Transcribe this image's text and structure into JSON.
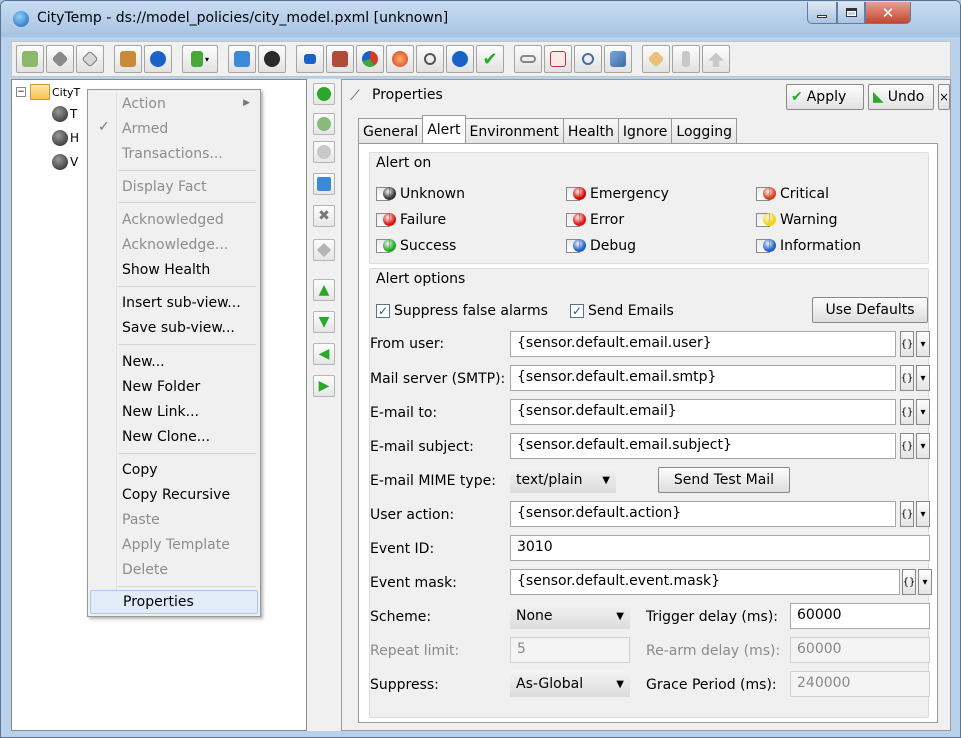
{
  "window": {
    "title": "CityTemp - ds://model_policies/city_model.pxml [unknown]"
  },
  "tree": {
    "root_label": "CityT",
    "children": [
      "T",
      "H",
      "V"
    ]
  },
  "context_menu": {
    "items": [
      {
        "label": "Action",
        "disabled": true,
        "submenu": true
      },
      {
        "label": "Armed",
        "disabled": true,
        "checked": true
      },
      {
        "label": "Transactions...",
        "disabled": true
      },
      {
        "label": "Display Fact",
        "disabled": true
      },
      {
        "label": "Acknowledged",
        "disabled": true
      },
      {
        "label": "Acknowledge...",
        "disabled": true
      },
      {
        "label": "Show Health",
        "disabled": false
      },
      {
        "label": "Insert sub-view...",
        "disabled": false
      },
      {
        "label": "Save sub-view...",
        "disabled": false
      },
      {
        "label": "New...",
        "disabled": false
      },
      {
        "label": "New Folder",
        "disabled": false
      },
      {
        "label": "New Link...",
        "disabled": false
      },
      {
        "label": "New Clone...",
        "disabled": false
      },
      {
        "label": "Copy",
        "disabled": false
      },
      {
        "label": "Copy Recursive",
        "disabled": false
      },
      {
        "label": "Paste",
        "disabled": true
      },
      {
        "label": "Apply Template",
        "disabled": true
      },
      {
        "label": "Delete",
        "disabled": true
      },
      {
        "label": "Properties",
        "disabled": false,
        "highlighted": true
      }
    ]
  },
  "properties": {
    "title": "Properties",
    "apply_label": "Apply",
    "undo_label": "Undo",
    "close_label": "×",
    "tabs": [
      "General",
      "Alert",
      "Environment",
      "Health",
      "Ignore",
      "Logging"
    ],
    "active_tab": "Alert"
  },
  "alert_on": {
    "title": "Alert on",
    "items": [
      {
        "label": "Unknown",
        "color": "#333333"
      },
      {
        "label": "Emergency",
        "color": "#d80000"
      },
      {
        "label": "Critical",
        "color": "#d83a1a"
      },
      {
        "label": "Failure",
        "color": "#e01010"
      },
      {
        "label": "Error",
        "color": "#e01010"
      },
      {
        "label": "Warning",
        "color": "#f2d600"
      },
      {
        "label": "Success",
        "color": "#1ca81c"
      },
      {
        "label": "Debug",
        "color": "#1a5fc8"
      },
      {
        "label": "Information",
        "color": "#1a5fc8"
      }
    ]
  },
  "alert_options": {
    "title": "Alert options",
    "suppress_false_alarms": "Suppress false alarms",
    "send_emails": "Send Emails",
    "use_defaults": "Use Defaults",
    "from_user_label": "From user:",
    "from_user_value": "{sensor.default.email.user}",
    "mail_server_label": "Mail server (SMTP):",
    "mail_server_value": "{sensor.default.email.smtp}",
    "email_to_label": "E-mail to:",
    "email_to_value": "{sensor.default.email}",
    "email_subject_label": "E-mail subject:",
    "email_subject_value": "{sensor.default.email.subject}",
    "mime_label": "E-mail MIME type:",
    "mime_value": "text/plain",
    "send_test_mail": "Send Test Mail",
    "user_action_label": "User action:",
    "user_action_value": "{sensor.default.action}",
    "event_id_label": "Event ID:",
    "event_id_value": "3010",
    "event_mask_label": "Event mask:",
    "event_mask_value": "{sensor.default.event.mask}",
    "scheme_label": "Scheme:",
    "scheme_value": "None",
    "trigger_delay_label": "Trigger delay (ms):",
    "trigger_delay_value": "60000",
    "repeat_limit_label": "Repeat limit:",
    "repeat_limit_value": "5",
    "rearm_delay_label": "Re-arm delay (ms):",
    "rearm_delay_value": "60000",
    "suppress_label": "Suppress:",
    "suppress_value": "As-Global",
    "grace_period_label": "Grace Period (ms):",
    "grace_period_value": "240000",
    "braces_glyph": "{}",
    "dropdown_glyph": "▾"
  }
}
